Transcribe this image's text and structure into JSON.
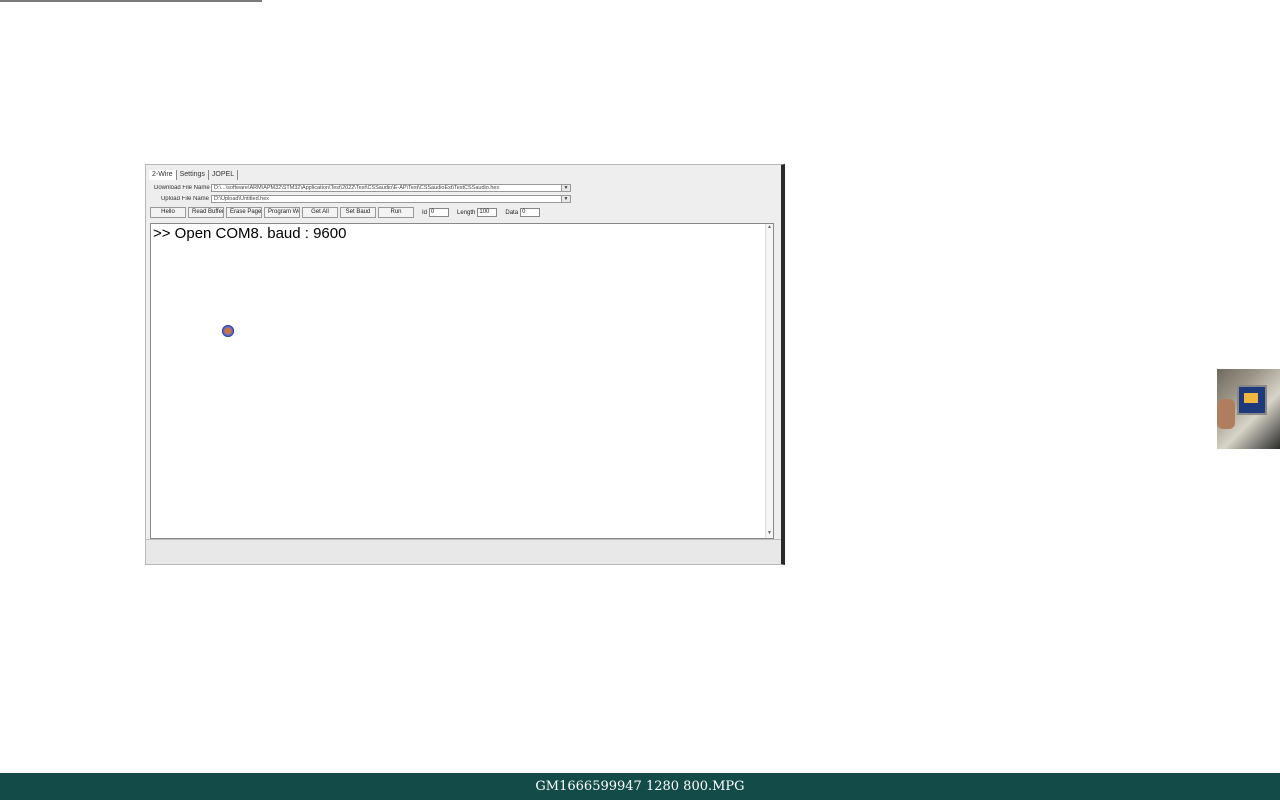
{
  "app": {
    "tabs": [
      "2-Wire",
      "Settings",
      "JOPEL"
    ],
    "download_label": "Download File Name",
    "download_value": "D:\\...\\software\\ARM\\APM32\\STM32\\Application\\Test\\2022\\Test\\CSSaudio\\E-AP\\Test\\CSSaudioExt\\TestCSSaudio.hex",
    "upload_label": "Upload File Name",
    "upload_value": "D:\\Upload\\Untitled.hex",
    "buttons": [
      "Hello",
      "Read Buffer",
      "Erase Page",
      "Program Word",
      "Get All",
      "Set Baud",
      "Run"
    ],
    "fields": [
      {
        "label": "Id",
        "value": "0"
      },
      {
        "label": "Length",
        "value": "100"
      },
      {
        "label": "Data",
        "value": "0"
      }
    ],
    "console_text": ">> Open COM8. baud : 9600"
  },
  "footer": {
    "filename": "GM1666599947 1280 800.MPG"
  }
}
